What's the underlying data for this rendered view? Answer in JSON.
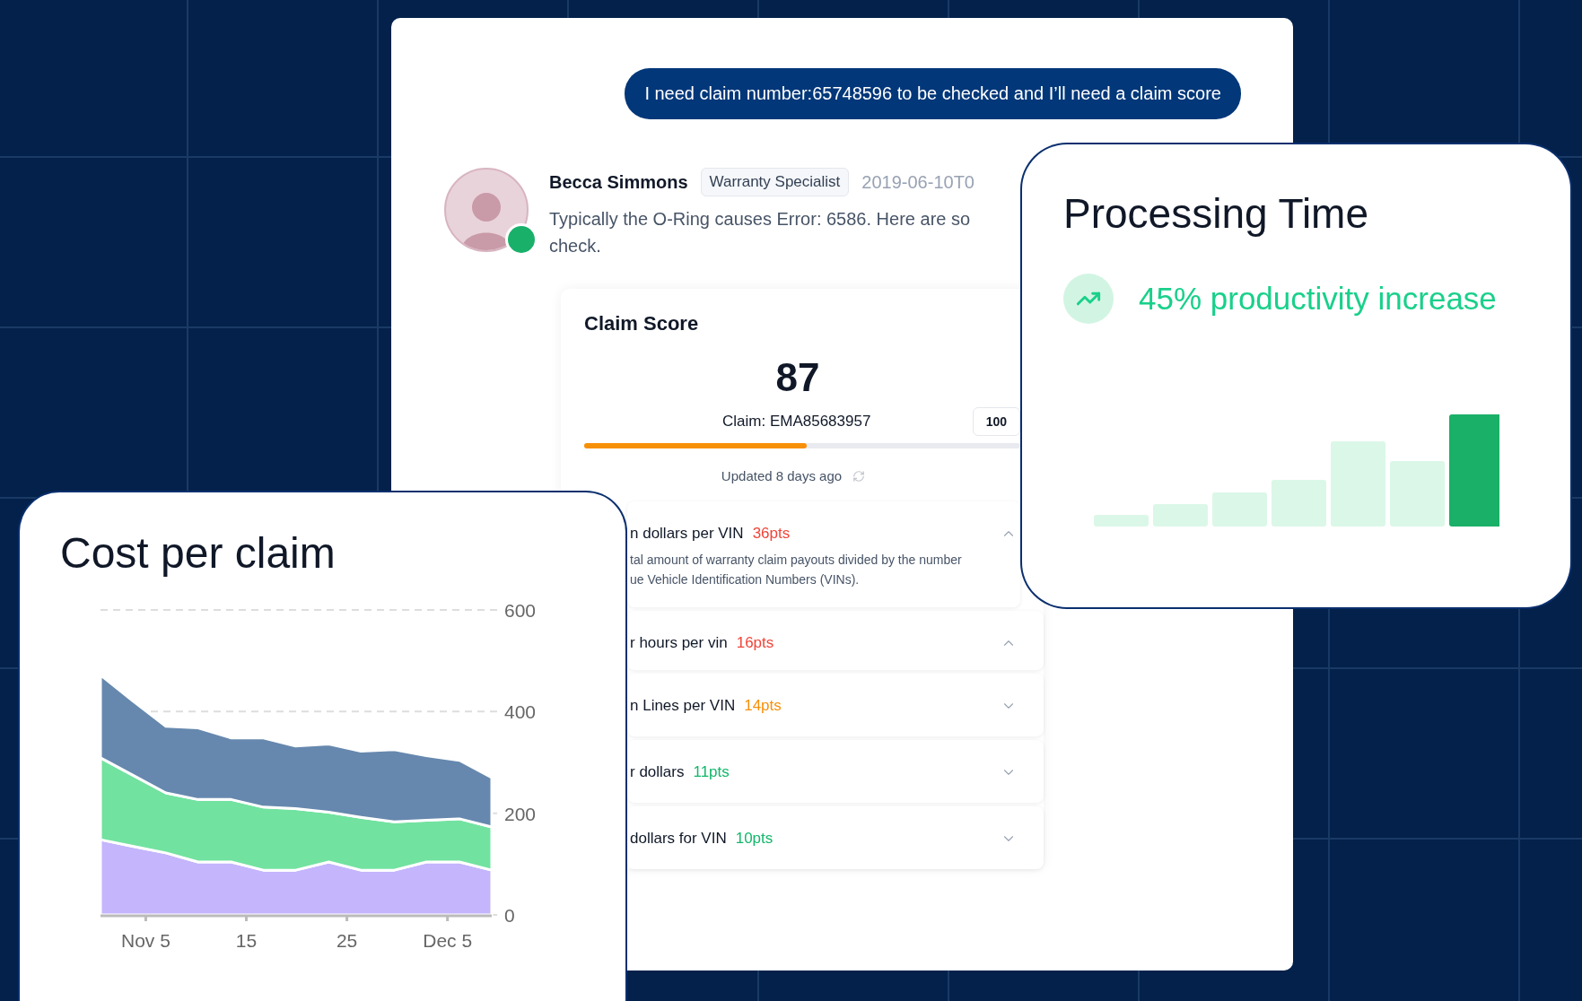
{
  "user_message": {
    "text": "I need claim number:65748596 to be checked and I’ll need a claim score"
  },
  "reply": {
    "author": "Becca Simmons",
    "role": "Warranty Specialist",
    "timestamp": "2019-06-10T0",
    "online": true,
    "message": "Typically the O-Ring causes Error: 6586. Here are so\ncheck."
  },
  "claim_score": {
    "title": "Claim Score",
    "score": "87",
    "claim": "Claim: EMA85683957",
    "max": "100",
    "level": 0.51,
    "updated": "Updated 8 days ago",
    "factors": [
      {
        "title": "n dollars per VIN",
        "points": "36pts",
        "color": "#f04438",
        "expanded": true,
        "description": "tal amount of warranty claim payouts divided by the number\nue Vehicle Identification Numbers (VINs)."
      },
      {
        "title": "r hours per vin",
        "points": "16pts",
        "color": "#f04438",
        "expanded": true
      },
      {
        "title": "n Lines per VIN",
        "points": "14pts",
        "color": "#f79009",
        "expanded": false
      },
      {
        "title": "r dollars",
        "points": "11pts",
        "color": "#12b76a",
        "expanded": false
      },
      {
        "title": "dollars for VIN",
        "points": "10pts",
        "color": "#12b76a",
        "expanded": false
      }
    ]
  },
  "processing_time": {
    "title": "Processing Time",
    "highlight": "45% productivity increase"
  },
  "cost_per_claim": {
    "title": "Cost per claim",
    "chart_data": {
      "type": "area",
      "stacked": true,
      "x": [
        0.5,
        3.7,
        7,
        10.2,
        13.5,
        16.7,
        19.9,
        23.2,
        26.4,
        29.7,
        32.9,
        36.2,
        39.4
      ],
      "series": [
        {
          "color": "#c4b5fd",
          "values": [
            148,
            135,
            122,
            104,
            104,
            88,
            88,
            104,
            88,
            88,
            104,
            104,
            88
          ]
        },
        {
          "color": "#72e2a0",
          "values": [
            161,
            140,
            118,
            123,
            123,
            124,
            121,
            98,
            104,
            95,
            82,
            85,
            85
          ]
        },
        {
          "color": "#6688ae",
          "values": [
            163,
            146,
            131,
            141,
            121,
            136,
            123,
            134,
            130,
            142,
            127,
            115,
            97
          ]
        }
      ],
      "xlim": [
        0.5,
        39.4
      ],
      "ylim": [
        0,
        600
      ],
      "xticks": [
        {
          "value": 5,
          "label": "Nov 5"
        },
        {
          "value": 15,
          "label": "15"
        },
        {
          "value": 25,
          "label": "25"
        },
        {
          "value": 35,
          "label": "Dec 5"
        }
      ],
      "yticks": [
        0,
        200,
        400,
        600
      ]
    }
  }
}
